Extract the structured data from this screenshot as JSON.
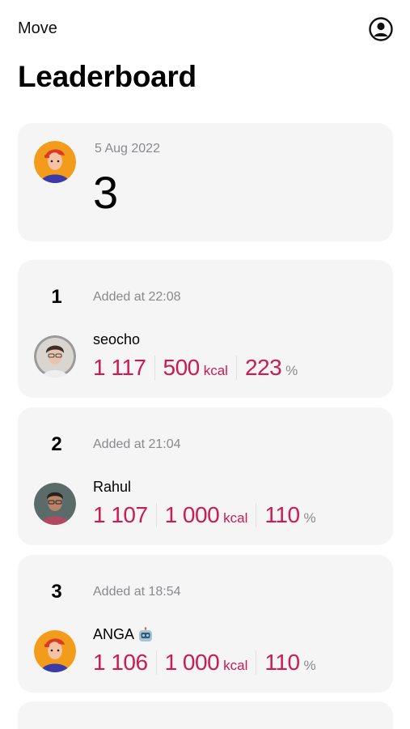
{
  "header": {
    "back_label": "Move",
    "title": "Leaderboard"
  },
  "icons": {
    "profile": "user-circle-icon",
    "robot": "robot-emoji-icon"
  },
  "colors": {
    "accent": "#cc1a52",
    "card_bg": "#f5f5f6",
    "muted": "#8a8a8e"
  },
  "summary": {
    "date": "5 Aug 2022",
    "rank": "3"
  },
  "entries": [
    {
      "rank": "1",
      "added": "Added at 22:08",
      "name": "seocho",
      "stat1": "1 117",
      "stat2": "500",
      "stat2_unit": "kcal",
      "stat3": "223",
      "stat3_unit": "%"
    },
    {
      "rank": "2",
      "added": "Added at 21:04",
      "name": "Rahul",
      "stat1": "1 107",
      "stat2": "1 000",
      "stat2_unit": "kcal",
      "stat3": "110",
      "stat3_unit": "%"
    },
    {
      "rank": "3",
      "added": "Added at 18:54",
      "name": "ANGA",
      "stat1": "1 106",
      "stat2": "1 000",
      "stat2_unit": "kcal",
      "stat3": "110",
      "stat3_unit": "%"
    }
  ]
}
